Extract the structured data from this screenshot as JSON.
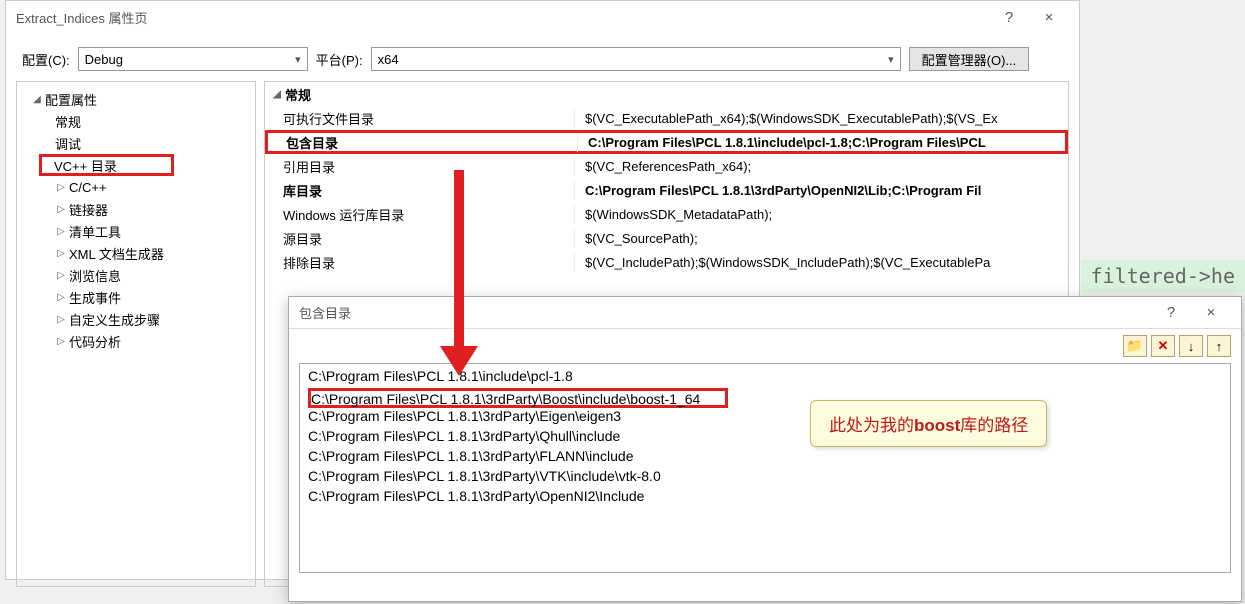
{
  "window": {
    "title": "Extract_Indices 属性页",
    "help": "?",
    "close": "×"
  },
  "config": {
    "label_config": "配置(C):",
    "config_value": "Debug",
    "label_platform": "平台(P):",
    "platform_value": "x64",
    "manager_btn": "配置管理器(O)..."
  },
  "tree": {
    "root": "配置属性",
    "items": [
      "常规",
      "调试",
      "VC++ 目录",
      "C/C++",
      "链接器",
      "清单工具",
      "XML 文档生成器",
      "浏览信息",
      "生成事件",
      "自定义生成步骤",
      "代码分析"
    ]
  },
  "grid": {
    "header": "常规",
    "rows": [
      {
        "k": "可执行文件目录",
        "v": "$(VC_ExecutablePath_x64);$(WindowsSDK_ExecutablePath);$(VS_Ex"
      },
      {
        "k": "包含目录",
        "v": "C:\\Program Files\\PCL 1.8.1\\include\\pcl-1.8;C:\\Program Files\\PCL",
        "bold": true,
        "mark": true
      },
      {
        "k": "引用目录",
        "v": "$(VC_ReferencesPath_x64);"
      },
      {
        "k": "库目录",
        "v": "C:\\Program Files\\PCL 1.8.1\\3rdParty\\OpenNI2\\Lib;C:\\Program Fil",
        "bold": true
      },
      {
        "k": "Windows 运行库目录",
        "v": "$(WindowsSDK_MetadataPath);"
      },
      {
        "k": "源目录",
        "v": "$(VC_SourcePath);"
      },
      {
        "k": "排除目录",
        "v": "$(VC_IncludePath);$(WindowsSDK_IncludePath);$(VC_ExecutablePa"
      }
    ]
  },
  "popup": {
    "title": "包含目录",
    "help": "?",
    "close": "×",
    "toolbar": {
      "new": "📁",
      "del": "✕",
      "down": "↓",
      "up": "↑"
    },
    "lines": [
      "C:\\Program Files\\PCL 1.8.1\\include\\pcl-1.8",
      "C:\\Program Files\\PCL 1.8.1\\3rdParty\\Boost\\include\\boost-1_64",
      "C:\\Program Files\\PCL 1.8.1\\3rdParty\\Eigen\\eigen3",
      "C:\\Program Files\\PCL 1.8.1\\3rdParty\\Qhull\\include",
      "C:\\Program Files\\PCL 1.8.1\\3rdParty\\FLANN\\include",
      "C:\\Program Files\\PCL 1.8.1\\3rdParty\\VTK\\include\\vtk-8.0",
      "C:\\Program Files\\PCL 1.8.1\\3rdParty\\OpenNI2\\Include"
    ]
  },
  "callout": {
    "prefix": "此处为我的",
    "bold": "boost",
    "suffix": "库的路径"
  },
  "bg_code": "filtered->he"
}
